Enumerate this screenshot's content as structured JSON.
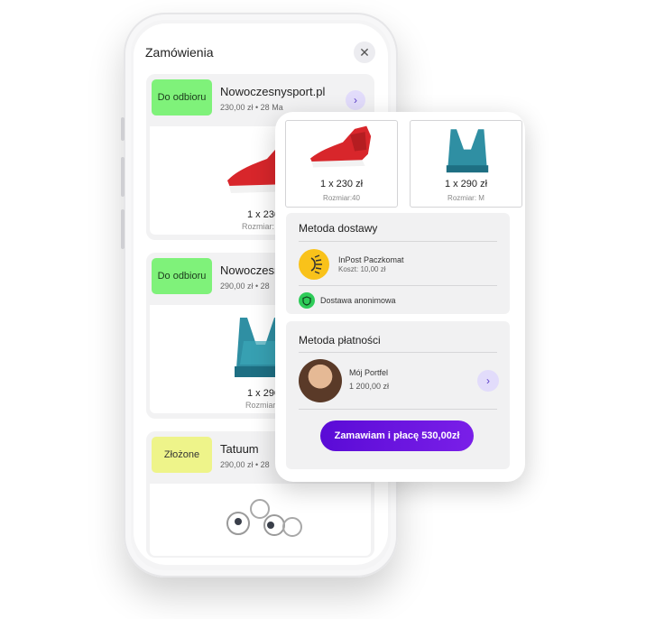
{
  "screen": {
    "title": "Zamówienia"
  },
  "orders": [
    {
      "status": "Do odbioru",
      "store": "Nowoczesnysport.pl",
      "meta": "230,00 zł  •  28 Ma",
      "qty": "1 x 230",
      "size": "Rozmiar: 40"
    },
    {
      "status": "Do odbioru",
      "store": "Nowoczesn",
      "meta": "290,00 zł  •  28",
      "qty": "1 x 290",
      "size": "Rozmiar: M"
    },
    {
      "status": "Złożone",
      "store": "Tatuum",
      "meta": "290,00 zł  •  28"
    }
  ],
  "checkout": {
    "products": [
      {
        "price": "1 x 230 zł",
        "size": "Rozmiar:40"
      },
      {
        "price": "1 x 290 zł",
        "size": "Rozmiar: M"
      }
    ],
    "delivery": {
      "title": "Metoda dostawy",
      "method_name": "InPost Paczkomat",
      "method_cost": "Koszt: 10,00 zł",
      "anonymous": "Dostawa anonimowa"
    },
    "payment": {
      "title": "Metoda płatności",
      "wallet_name": "Mój Portfel",
      "wallet_balance": "1 200,00 zł"
    },
    "pay_button": "Zamawiam i płacę 530,00zł"
  },
  "colors": {
    "accent": "#6a14e0",
    "badge_green": "#7ff27a",
    "badge_yellow": "#eef48a",
    "shield_green": "#2ecc59",
    "inpost_yellow": "#f9c21a"
  }
}
